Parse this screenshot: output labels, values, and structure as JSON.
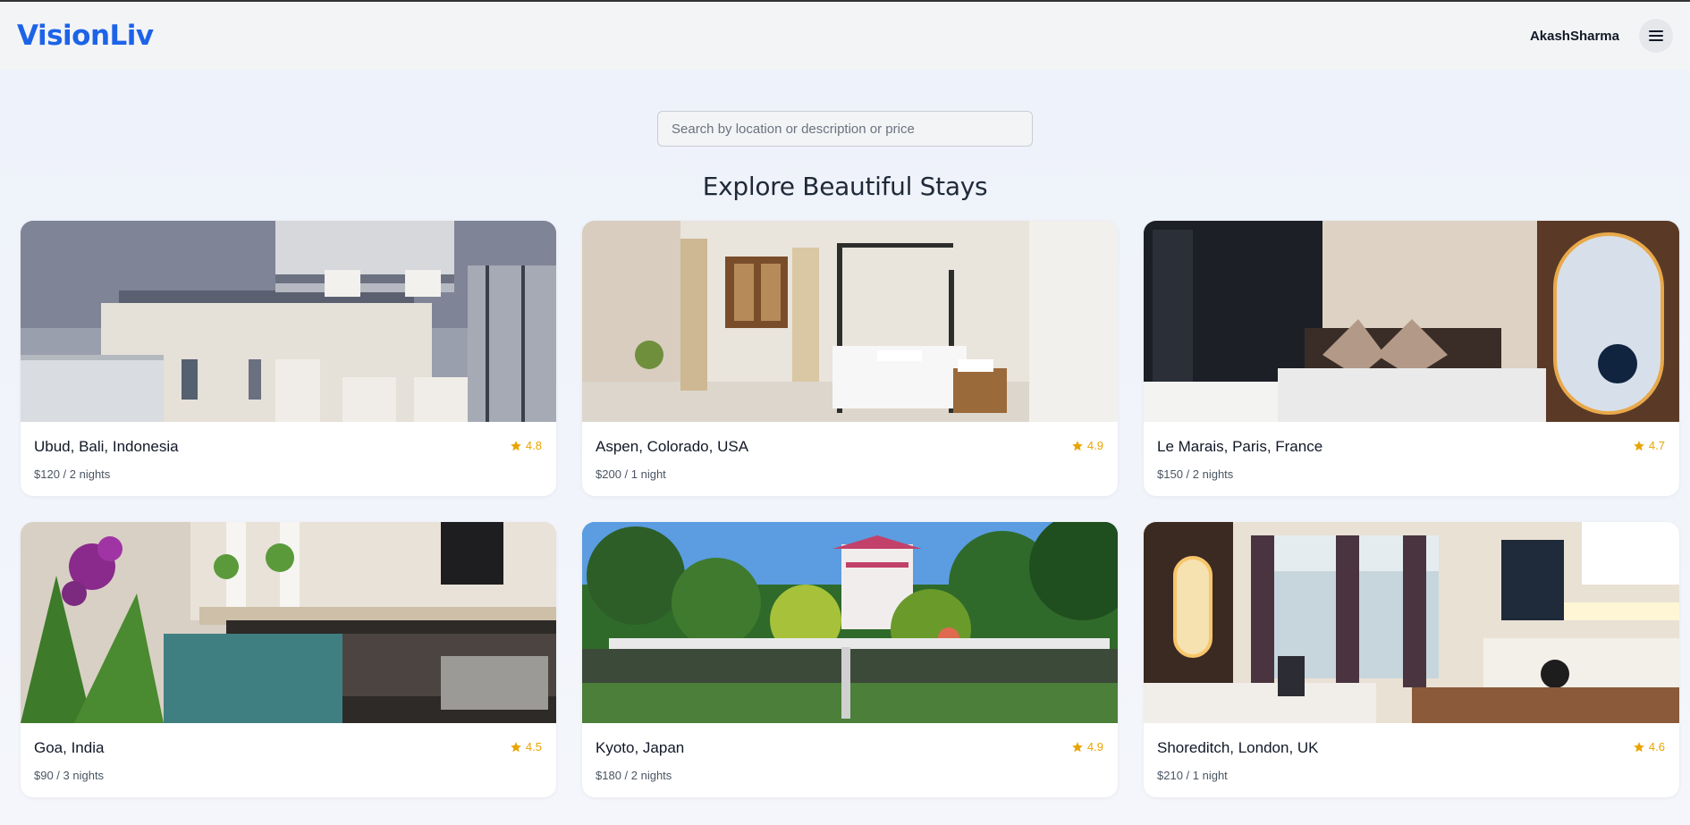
{
  "header": {
    "brand": "VisionLiv",
    "username": "AkashSharma"
  },
  "search": {
    "placeholder": "Search by location or description or price"
  },
  "page_title": "Explore Beautiful Stays",
  "listings": [
    {
      "location": "Ubud, Bali, Indonesia",
      "price": "$120 / 2 nights",
      "rating": "4.8"
    },
    {
      "location": "Aspen, Colorado, USA",
      "price": "$200 / 1 night",
      "rating": "4.9"
    },
    {
      "location": "Le Marais, Paris, France",
      "price": "$150 / 2 nights",
      "rating": "4.7"
    },
    {
      "location": "Goa, India",
      "price": "$90 / 3 nights",
      "rating": "4.5"
    },
    {
      "location": "Kyoto, Japan",
      "price": "$180 / 2 nights",
      "rating": "4.9"
    },
    {
      "location": "Shoreditch, London, UK",
      "price": "$210 / 1 night",
      "rating": "4.6"
    }
  ],
  "colors": {
    "brand": "#1d63e8",
    "star": "#e9a400"
  }
}
